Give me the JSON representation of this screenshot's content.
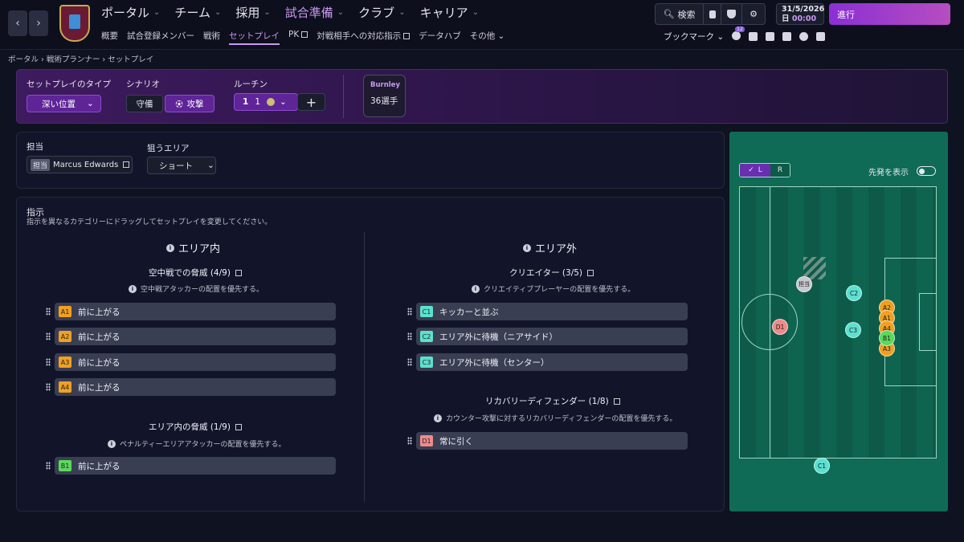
{
  "nav": {
    "back": "‹",
    "forward": "›",
    "main": [
      {
        "label": "ポータル"
      },
      {
        "label": "チーム"
      },
      {
        "label": "採用"
      },
      {
        "label": "試合準備",
        "active": true
      },
      {
        "label": "クラブ"
      },
      {
        "label": "キャリア"
      }
    ],
    "sub": [
      "概要",
      "試合登録メンバー",
      "戦術",
      "セットプレイ",
      "PK",
      "対戦相手への対応指示",
      "データハブ",
      "その他"
    ],
    "search": "検索",
    "date": "31/5/2026",
    "day": "日",
    "time": "00:00",
    "proceed": "進行",
    "bookmarks": "ブックマーク",
    "badge_count": "12"
  },
  "breadcrumb": {
    "a": "ポータル",
    "b": "戦術プランナー",
    "c": "セットプレイ"
  },
  "setpiece": {
    "type_label": "セットプレイのタイプ",
    "type_value": "深い位置",
    "scenario_label": "シナリオ",
    "defense": "守備",
    "attack": "攻撃",
    "routine_label": "ルーチン",
    "routine_a": "1",
    "routine_b": "1",
    "club": "Burnley",
    "players": "36選手"
  },
  "assign": {
    "label": "担当",
    "tag": "担当",
    "player": "Marcus Edwards",
    "area_label": "狙うエリア",
    "area_value": "ショート"
  },
  "instr": {
    "title": "指示",
    "desc": "指示を異なるカテゴリーにドラッグしてセットプレイを変更してください。",
    "inside": {
      "title": "エリア内",
      "g1": {
        "title": "空中戦での脅威 (4/9)",
        "desc": "空中戦アタッカーの配置を優先する。",
        "rows": [
          {
            "tag": "A1",
            "text": "前に上がる"
          },
          {
            "tag": "A2",
            "text": "前に上がる"
          },
          {
            "tag": "A3",
            "text": "前に上がる"
          },
          {
            "tag": "A4",
            "text": "前に上がる"
          }
        ]
      },
      "g2": {
        "title": "エリア内の脅威 (1/9)",
        "desc": "ペナルティーエリアアタッカーの配置を優先する。",
        "rows": [
          {
            "tag": "B1",
            "text": "前に上がる"
          }
        ]
      }
    },
    "outside": {
      "title": "エリア外",
      "g1": {
        "title": "クリエイター (3/5)",
        "desc": "クリエイティブプレーヤーの配置を優先する。",
        "rows": [
          {
            "tag": "C1",
            "text": "キッカーと並ぶ"
          },
          {
            "tag": "C2",
            "text": "エリア外に待機（ニアサイド）"
          },
          {
            "tag": "C3",
            "text": "エリア外に待機（センター）"
          }
        ]
      },
      "g2": {
        "title": "リカバリーディフェンダー (1/8)",
        "desc": "カウンター攻撃に対するリカバリーディフェンダーの配置を優先する。",
        "rows": [
          {
            "tag": "D1",
            "text": "常に引く"
          }
        ]
      }
    }
  },
  "pitch": {
    "left": "L",
    "right": "R",
    "show_starters": "先発を表示",
    "taker": "担当",
    "colors": {
      "A": "#f0a020",
      "B": "#5cd85c",
      "C": "#5ce0d0",
      "D": "#f08a8a"
    }
  }
}
